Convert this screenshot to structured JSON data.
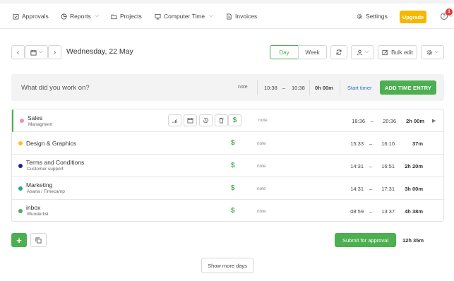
{
  "nav": {
    "approvals": "Approvals",
    "reports": "Reports",
    "projects": "Projects",
    "computer_time": "Computer Time",
    "invoices": "Invoices",
    "settings": "Settings",
    "upgrade": "Upgrade",
    "help": "?",
    "notifications_count": "1"
  },
  "toolbar": {
    "date": "Wednesday, 22 May",
    "day": "Day",
    "week": "Week",
    "bulk_edit": "Bulk edit"
  },
  "entry": {
    "placeholder": "What did you work on?",
    "note": "note",
    "start": "10:38",
    "dash": "–",
    "end": "10:38",
    "duration": "0h 00m",
    "start_timer": "Start timer",
    "add": "ADD TIME ENTRY"
  },
  "rows": [
    {
      "project": "Sales",
      "client": "Managment",
      "color": "#f48fb1",
      "note": "note",
      "start": "18:36",
      "end": "20:36",
      "duration": "2h 00m"
    },
    {
      "project": "Design & Graphics",
      "client": "",
      "color": "#fbc02d",
      "note": "note",
      "start": "15:33",
      "end": "16:10",
      "duration": "37m"
    },
    {
      "project": "Terms and Conditions",
      "client": "Customer support",
      "color": "#1a237e",
      "note": "note",
      "start": "14:31",
      "end": "16:51",
      "duration": "2h 20m"
    },
    {
      "project": "Marketing",
      "client": "Asana / Timecamp",
      "color": "#26a69a",
      "note": "note",
      "start": "14:31",
      "end": "17:31",
      "duration": "3h 00m"
    },
    {
      "project": "inbox",
      "client": "Wunderlist",
      "color": "#4caf50",
      "note": "note",
      "start": "08:59",
      "end": "13:37",
      "duration": "4h 38m"
    }
  ],
  "row_dash": "–",
  "footer": {
    "plus": "+",
    "submit": "Submit for approval",
    "total": "12h 35m",
    "show_more": "Show more days"
  }
}
